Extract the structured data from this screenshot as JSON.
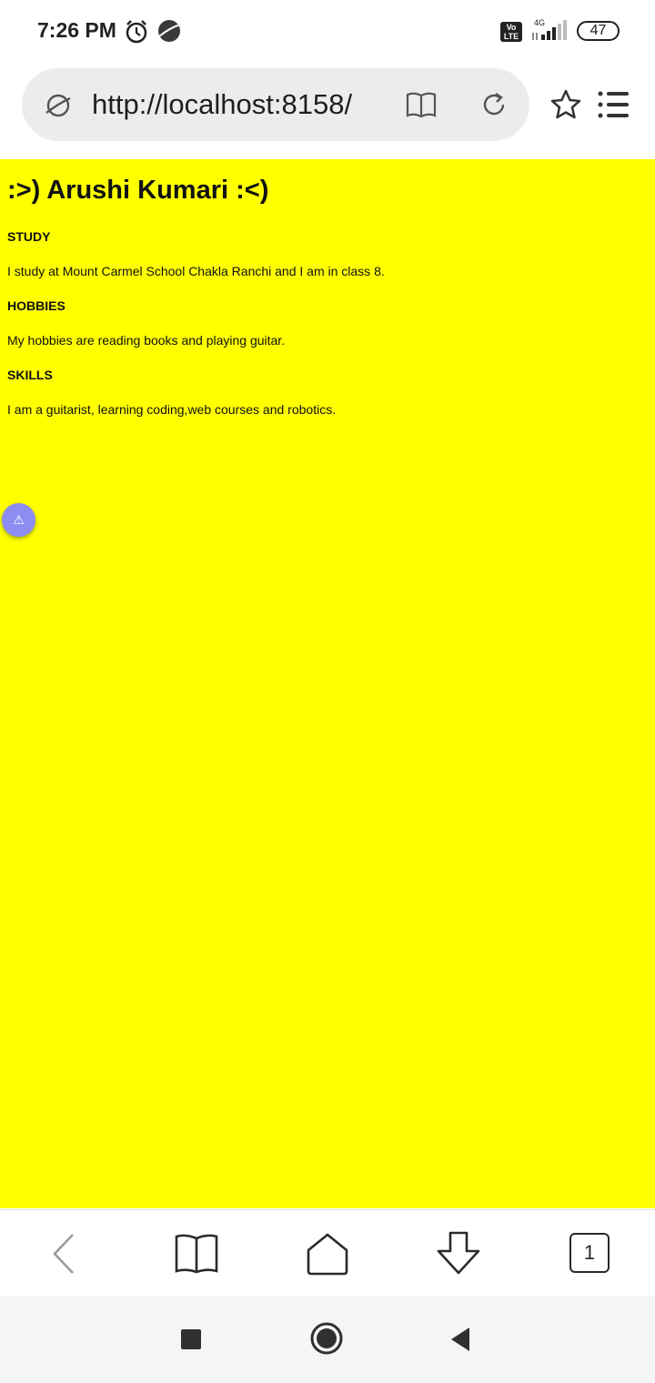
{
  "status_bar": {
    "time": "7:26 PM",
    "volte_label": "Vo\nLTE",
    "network": "4G",
    "battery": "47"
  },
  "browser": {
    "url": "http://localhost:8158/",
    "tabs_count": "1"
  },
  "page": {
    "title": ":>) Arushi Kumari :<)",
    "sections": [
      {
        "label": "STUDY",
        "text": "I study at Mount Carmel School Chakla Ranchi and I am in class 8."
      },
      {
        "label": "HOBBIES",
        "text": "My hobbies are reading books and playing guitar."
      },
      {
        "label": "SKILLS",
        "text": "I am a guitarist, learning coding,web courses and robotics."
      }
    ],
    "background_color": "#ffff00",
    "fab_icon": "warning-icon",
    "fab_glyph": "⚠"
  }
}
